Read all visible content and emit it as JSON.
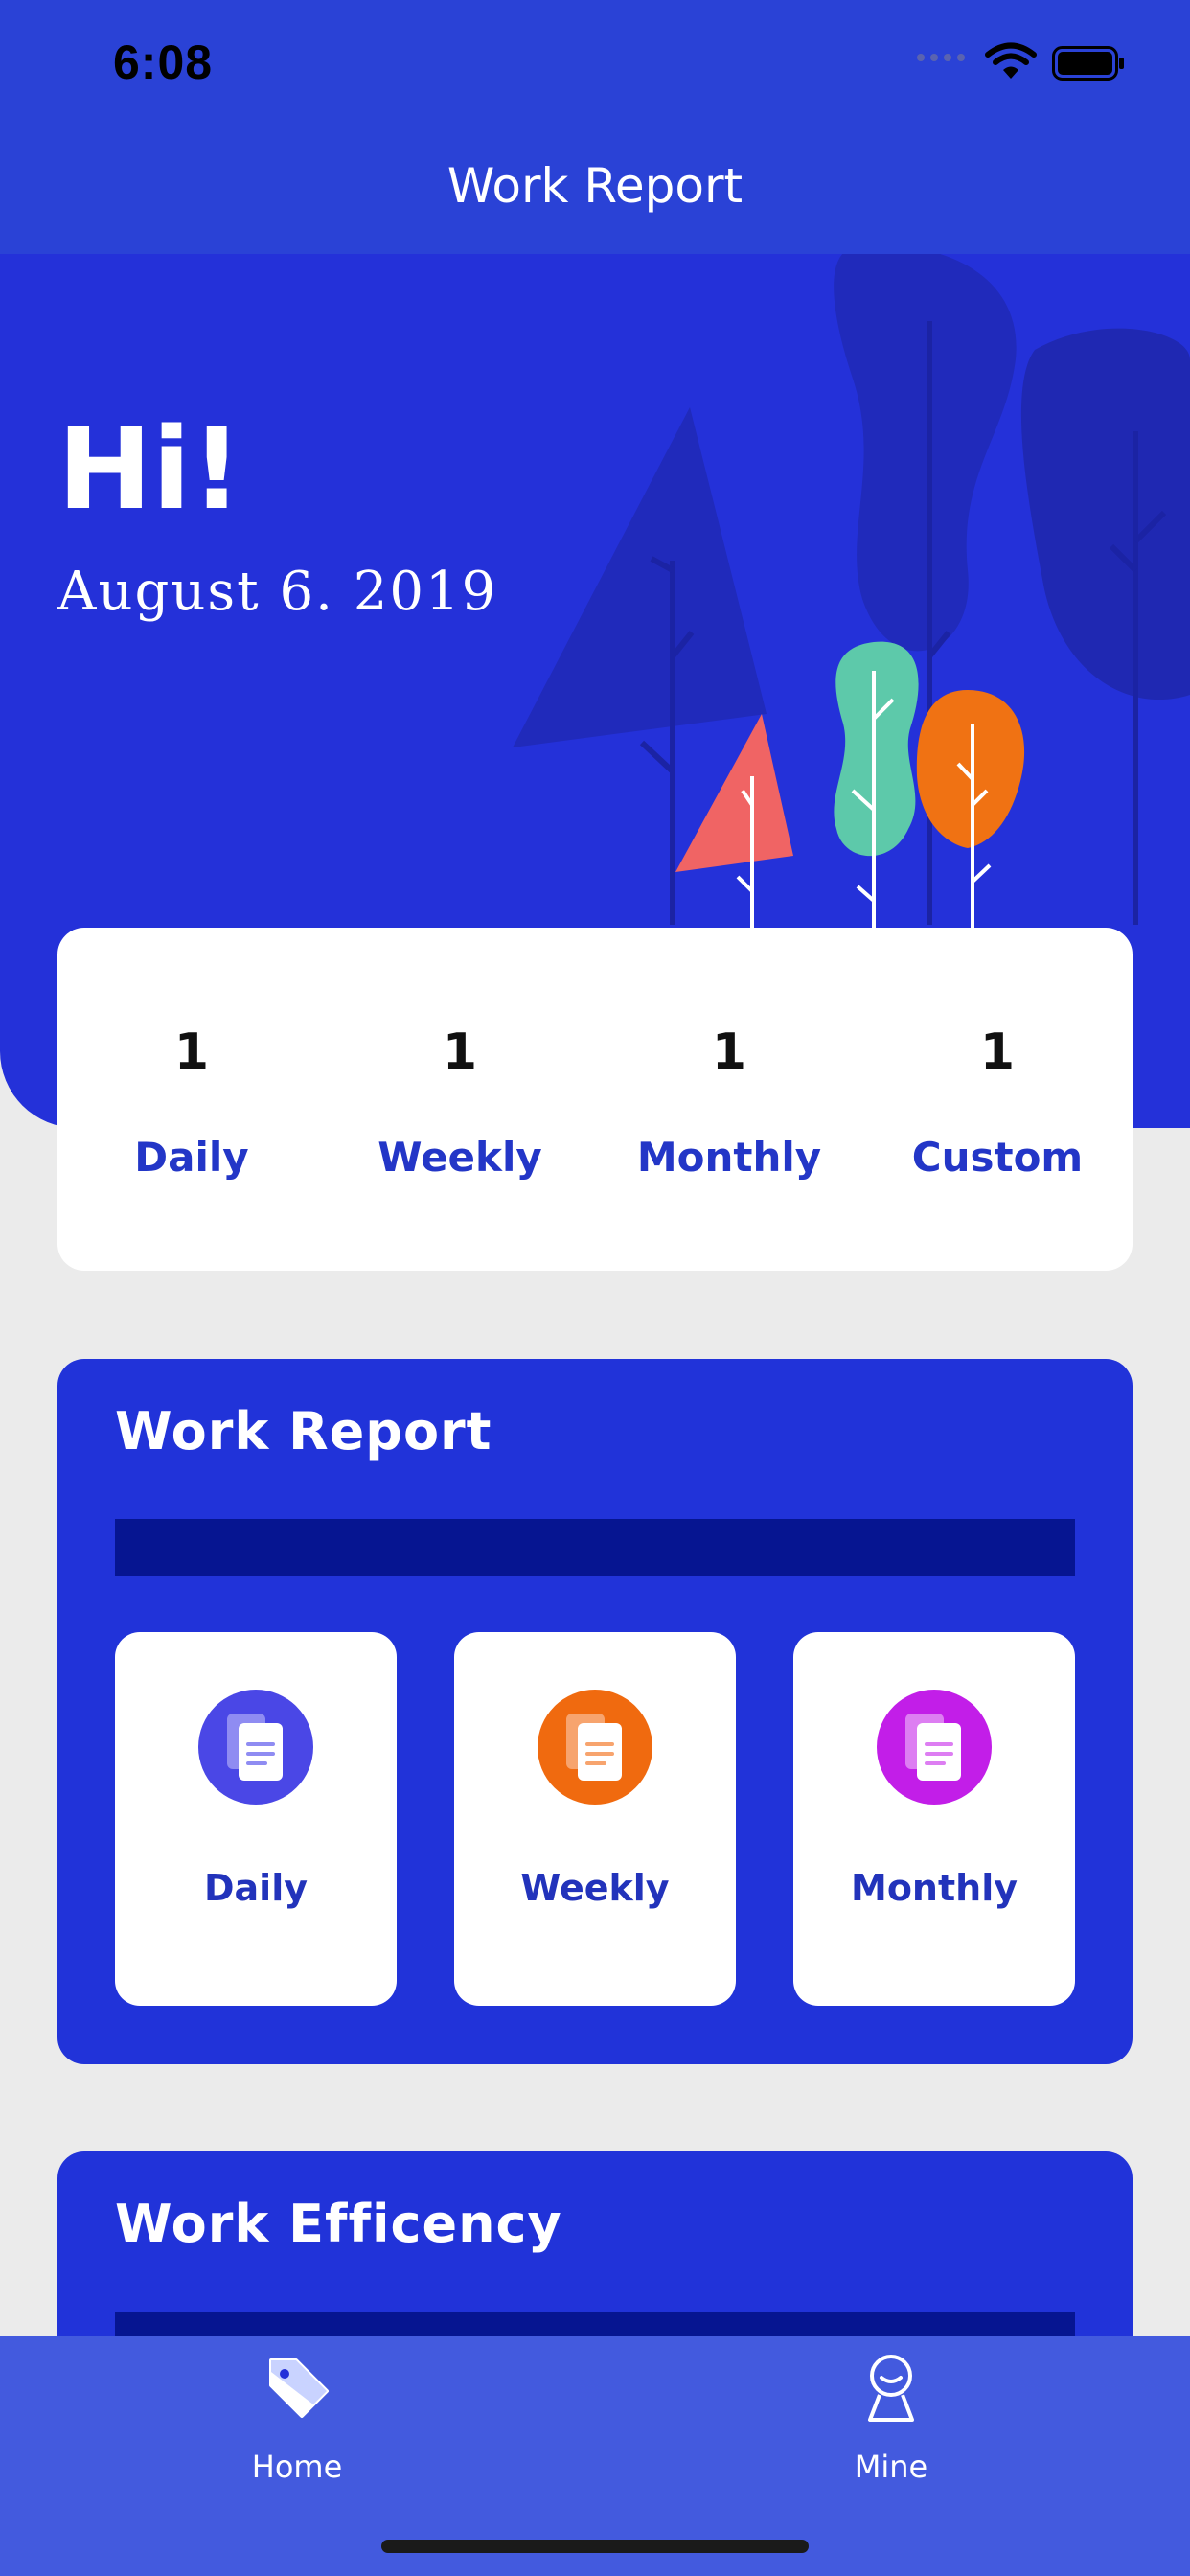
{
  "status_bar": {
    "time": "6:08"
  },
  "nav": {
    "title": "Work Report"
  },
  "hero": {
    "greeting": "Hi!",
    "date": "August  6.  2019"
  },
  "stats": [
    {
      "count": "1",
      "label": "Daily"
    },
    {
      "count": "1",
      "label": "Weekly"
    },
    {
      "count": "1",
      "label": "Monthly"
    },
    {
      "count": "1",
      "label": "Custom"
    }
  ],
  "work_report": {
    "title": "Work Report",
    "tiles": [
      {
        "label": "Daily",
        "icon": "document-icon",
        "color": "#4a47e6"
      },
      {
        "label": "Weekly",
        "icon": "document-icon",
        "color": "#f06a0f"
      },
      {
        "label": "Monthly",
        "icon": "document-icon",
        "color": "#c21ee8"
      }
    ]
  },
  "work_efficiency": {
    "title": "Work Efficency"
  },
  "tab_bar": {
    "items": [
      {
        "label": "Home",
        "icon": "tag-icon"
      },
      {
        "label": "Mine",
        "icon": "person-icon"
      }
    ]
  },
  "colors": {
    "primary": "#2431d9",
    "card_bg": "#ffffff",
    "label_blue": "#2336c7",
    "tab_bar": "#435ade"
  }
}
